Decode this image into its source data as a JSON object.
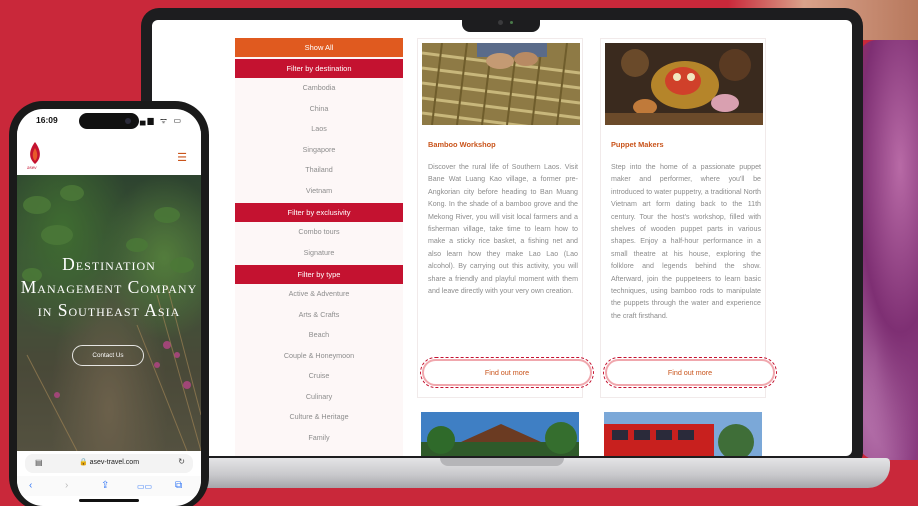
{
  "laptop_site": {
    "filters": {
      "show_all": "Show All",
      "groups": [
        {
          "heading": "Filter by destination",
          "items": [
            "Cambodia",
            "China",
            "Laos",
            "Singapore",
            "Thailand",
            "Vietnam"
          ]
        },
        {
          "heading": "Filter by exclusivity",
          "items": [
            "Combo tours",
            "Signature"
          ]
        },
        {
          "heading": "Filter by type",
          "items": [
            "Active & Adventure",
            "Arts & Crafts",
            "Beach",
            "Couple & Honeymoon",
            "Cruise",
            "Culinary",
            "Culture & Heritage",
            "Family"
          ]
        }
      ]
    },
    "cards": [
      {
        "title": "Bamboo Workshop",
        "description": "Discover the rural life of Southern Laos. Visit Bane Wat Luang Kao village, a former pre-Angkorian city before heading to Ban Muang Kong. In the shade of a bamboo grove and the Mekong River, you will visit local farmers and a fisherman village, take time to learn how to make a sticky rice basket, a fishing net and also learn how they make Lao Lao (Lao alcohol). By carrying out this activity, you will share a friendly and playful moment with them and leave directly with your very own creation.",
        "button": "Find out more"
      },
      {
        "title": "Puppet Makers",
        "description": "Step into the home of a passionate puppet maker and performer, where you'll be introduced to water puppetry, a traditional North Vietnam art form dating back to the 11th century. Tour the host's workshop, filled with shelves of wooden puppet parts in various shapes. Enjoy a half-hour performance in a small theatre at his house, exploring the folklore and legends behind the show. Afterward, join the puppeteers to learn basic techniques, using bamboo rods to manipulate the puppets through the water and experience the craft firsthand.",
        "button": "Find out more"
      }
    ]
  },
  "phone": {
    "status": {
      "time": "16:09",
      "icons": "▂▄▆ ᯤ ▭"
    },
    "logo_text": "asev",
    "hero_title": "Destination Management Company in Southeast Asia",
    "contact_button": "Contact Us",
    "url": "asev-travel.com",
    "bottom_icons": [
      "‹",
      "›",
      "⇪",
      "▭▭",
      "⧉"
    ]
  },
  "colors": {
    "background": "#c9283a",
    "show_all": "#e05a1f",
    "filter_heading": "#c41230",
    "card_title": "#c9541b"
  }
}
